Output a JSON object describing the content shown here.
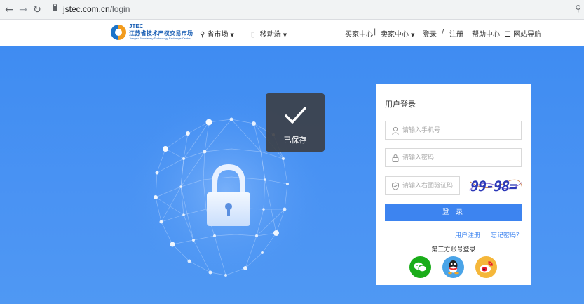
{
  "browser": {
    "back_icon": "arrow-left-icon",
    "forward_icon": "arrow-right-icon",
    "reload_icon": "reload-icon",
    "url_host": "jstec.com.cn",
    "url_path": "/login"
  },
  "header": {
    "logo_abbr": "JTEC",
    "logo_cn": "江苏省技术产权交易市场",
    "logo_en": "Jiangsu Proprietary Technology Exchange Center",
    "nav": {
      "province_market": "省市场",
      "mobile": "移动端",
      "buyer_center": "买家中心",
      "separator1": "|",
      "seller_center": "卖家中心",
      "login": "登录",
      "separator2": "/",
      "register": "注册",
      "help_center": "帮助中心",
      "site_nav": "网站导航"
    }
  },
  "toast": {
    "text": "已保存",
    "icon": "checkmark-icon"
  },
  "login": {
    "title": "用户登录",
    "phone_placeholder": "请输入手机号",
    "password_placeholder": "请输入密码",
    "captcha_placeholder": "请输入右图验证码",
    "captcha_text": "99-98=",
    "submit_label": "登 录",
    "register_link": "用户注册",
    "forgot_link": "忘记密码？",
    "third_party_title": "第三方账号登录",
    "social": [
      "wechat-icon",
      "qq-icon",
      "weibo-icon"
    ]
  },
  "colors": {
    "hero_blue": "#4a93f3",
    "primary": "#3d84f0",
    "wechat": "#1aad19",
    "qq": "#4aa4e8",
    "weibo": "#f5b73a"
  }
}
